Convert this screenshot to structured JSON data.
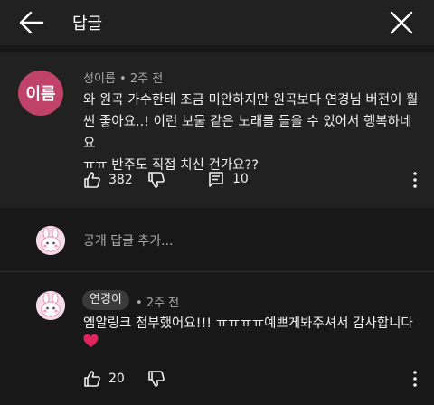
{
  "header": {
    "title": "답글",
    "back_icon": "arrow-left-icon",
    "close_icon": "close-icon"
  },
  "comment": {
    "avatar_text": "이름",
    "avatar_color": "#c0426a",
    "author": "성이름",
    "time": "2주 전",
    "text_lines": [
      "와 원곡 가수한테 조금 미안하지만 원곡보다 연경님 버전이 훨",
      "씬 좋아요..! 이런 보물 같은 노래를 들을 수 있어서 행복하네요",
      "ㅠㅠ 반주도 직접 치신 건가요??"
    ],
    "likes": "382",
    "replies": "10"
  },
  "add_reply": {
    "placeholder": "공개 답글 추가..."
  },
  "reply": {
    "author": "연경이",
    "time": "2주 전",
    "text": "엠알링크 첨부했어요!!! ㅠㅠㅠㅠ예쁘게봐주셔서 감사합니다",
    "emoji_icon": "red-heart-icon",
    "likes": "20"
  },
  "colors": {
    "background": "#181818",
    "panel": "#212121",
    "text": "#f1f1f1",
    "muted": "#aaaaaa",
    "heart": "#e0245e"
  }
}
